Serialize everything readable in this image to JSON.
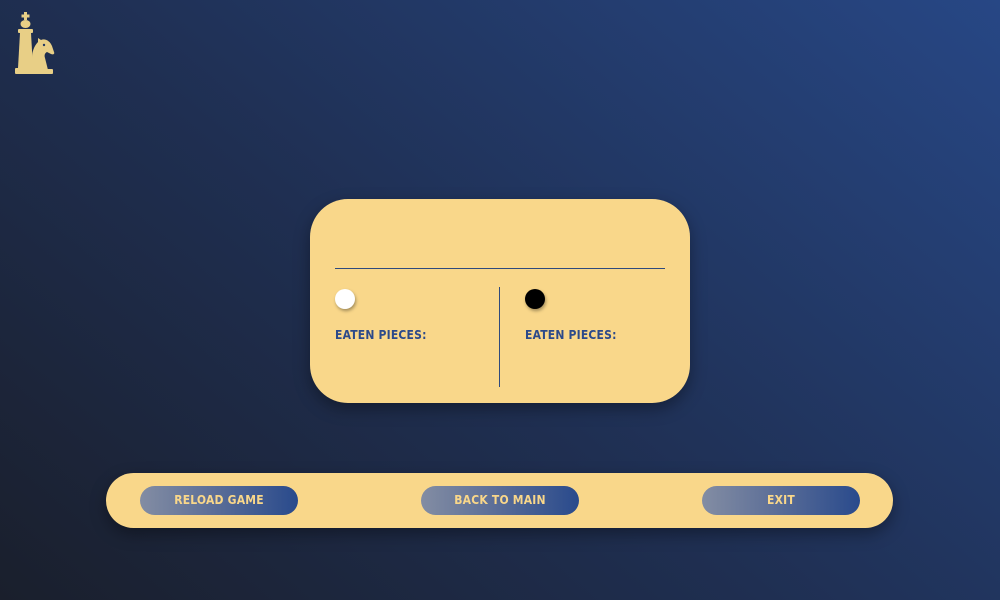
{
  "logo": {
    "icon": "chess-king-knight-logo",
    "color": "#e8cf86"
  },
  "card": {
    "title": "",
    "white_player": {
      "icon": "white-piece-icon",
      "eaten_label": "EATEN PIECES:",
      "eaten_pieces": ""
    },
    "black_player": {
      "icon": "black-piece-icon",
      "eaten_label": "EATEN PIECES:",
      "eaten_pieces": ""
    }
  },
  "actions": {
    "reload_label": "RELOAD GAME",
    "main_label": "BACK TO MAIN",
    "exit_label": "EXIT"
  },
  "colors": {
    "panel": "#f9d78a",
    "accent": "#2c4a8a",
    "background_dark": "#1a1f2c",
    "background_light": "#274785"
  }
}
